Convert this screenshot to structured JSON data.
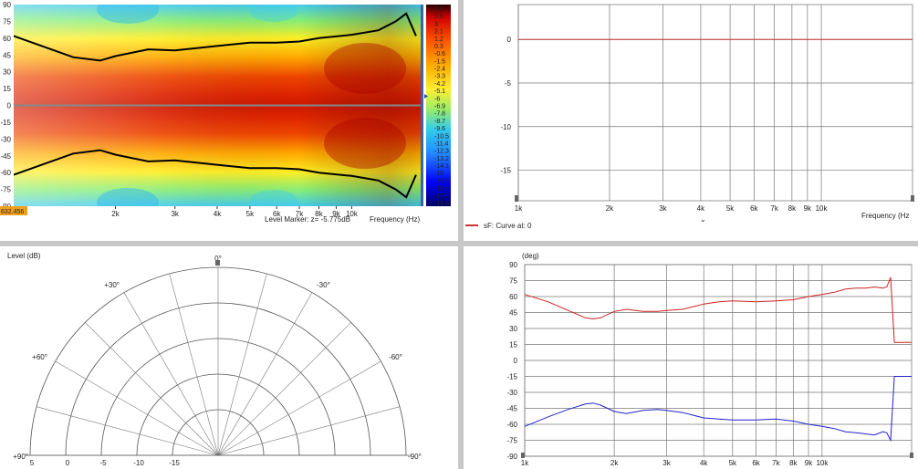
{
  "sonogram": {
    "y_ticks": [
      "90",
      "75",
      "60",
      "45",
      "30",
      "15",
      "0",
      "-15",
      "-30",
      "-45",
      "-60",
      "-75",
      "-90"
    ],
    "x_ticks": [
      "2k",
      "3k",
      "4k",
      "5k",
      "6k",
      "7k",
      "8k",
      "9k",
      "10k"
    ],
    "x_tick_freqs": [
      2000,
      3000,
      4000,
      5000,
      6000,
      7000,
      8000,
      9000,
      10000
    ],
    "x_range": [
      1000,
      16000
    ],
    "y_range": [
      -90,
      90
    ],
    "cursor_readout": "632.456",
    "marker_label": "Level Marker: z= -5.775dB",
    "freq_label": "Frequency (Hz)",
    "colorbar_labels": [
      "4.8",
      "3.9",
      "3",
      "2.1",
      "1.2",
      "0.3",
      "-0.6",
      "-1.5",
      "-2.4",
      "-3.3",
      "-4.2",
      "-5.1",
      "-6",
      "-6.9",
      "-7.8",
      "-8.7",
      "-9.6",
      "-10.5",
      "-11.4",
      "-12.3",
      "-13.2",
      "-14.1",
      "-15",
      "-15.9",
      "-16.8",
      "-17.7",
      "-18.6"
    ],
    "colors": {
      "hot": "#cc1000",
      "warm": "#ffcc00",
      "cool": "#33ccee",
      "cold": "#0000ff"
    }
  },
  "response": {
    "y_ticks": [
      "0",
      "-5",
      "-10",
      "-15"
    ],
    "y_values": [
      0,
      -5,
      -10,
      -15
    ],
    "y_range": [
      -18.5,
      4
    ],
    "x_ticks": [
      "1k",
      "2k",
      "3k",
      "4k",
      "5k",
      "6k",
      "7k",
      "8k",
      "9k",
      "10k"
    ],
    "x_tick_freqs": [
      1000,
      2000,
      3000,
      4000,
      5000,
      6000,
      7000,
      8000,
      9000,
      10000
    ],
    "x_range": [
      1000,
      20000
    ],
    "freq_label": "Frequency (Hz",
    "legend_label": "sF: Curve at: 0",
    "legend_color": "#cc3333",
    "curve_level": 0
  },
  "polar": {
    "level_label": "Level (dB)",
    "angle_labels": [
      "0°",
      "+30°",
      "-30°",
      "+60°",
      "-60°",
      "+90°",
      "-90°"
    ],
    "ring_labels": [
      "5",
      "0",
      "-5",
      "-10",
      "-15"
    ]
  },
  "phase": {
    "y_unit": "(deg)",
    "y_ticks": [
      "90",
      "75",
      "60",
      "45",
      "30",
      "15",
      "0",
      "-15",
      "-30",
      "-45",
      "-60",
      "-75",
      "-90"
    ],
    "y_range": [
      -90,
      90
    ],
    "x_ticks": [
      "1k",
      "2k",
      "3k",
      "4k",
      "5k",
      "6k",
      "7k",
      "8k",
      "9k",
      "10k"
    ],
    "x_tick_freqs": [
      1000,
      2000,
      3000,
      4000,
      5000,
      6000,
      7000,
      8000,
      9000,
      10000
    ],
    "x_range": [
      1000,
      20000
    ]
  },
  "chart_data": [
    {
      "type": "heatmap",
      "title": "",
      "xlabel": "Frequency (Hz)",
      "ylabel": "",
      "x_scale": "log",
      "xlim": [
        1000,
        16000
      ],
      "ylim": [
        -90,
        90
      ],
      "colorbar_range": [
        -18.6,
        4.8
      ],
      "level_marker": -5.775,
      "contour_upper": {
        "x": [
          1000,
          1500,
          1800,
          2000,
          2500,
          3000,
          4000,
          5000,
          6000,
          7000,
          8000,
          10000,
          12000,
          13500,
          14500,
          15000,
          15500
        ],
        "y": [
          62,
          43,
          40,
          44,
          50,
          49,
          53,
          56,
          56,
          57,
          60,
          63,
          67,
          75,
          82,
          72,
          62
        ]
      },
      "contour_lower": {
        "x": [
          1000,
          1500,
          1800,
          2000,
          2500,
          3000,
          4000,
          5000,
          6000,
          7000,
          8000,
          10000,
          12000,
          13500,
          14500,
          15000,
          15500
        ],
        "y": [
          -62,
          -43,
          -40,
          -44,
          -50,
          -49,
          -53,
          -56,
          -56,
          -57,
          -60,
          -63,
          -67,
          -75,
          -82,
          -72,
          -62
        ]
      }
    },
    {
      "type": "line",
      "title": "",
      "xlabel": "Frequency (Hz",
      "x_scale": "log",
      "xlim": [
        1000,
        20000
      ],
      "ylim": [
        -18.5,
        4
      ],
      "series": [
        {
          "name": "sF: Curve at: 0",
          "x": [
            1000,
            20000
          ],
          "y": [
            0,
            0
          ]
        }
      ]
    },
    {
      "type": "line",
      "title": "",
      "ylabel": "(deg)",
      "x_scale": "log",
      "xlim": [
        1000,
        20000
      ],
      "ylim": [
        -90,
        90
      ],
      "series": [
        {
          "x": [
            1000,
            1200,
            1400,
            1600,
            1700,
            1800,
            2000,
            2200,
            2500,
            2800,
            3000,
            3400,
            4000,
            4500,
            5000,
            6000,
            7000,
            8000,
            9000,
            10000,
            11000,
            12000,
            13000,
            14000,
            15000,
            16000,
            16500,
            17000,
            17500,
            20000
          ],
          "y": [
            62,
            55,
            47,
            40,
            39,
            40,
            46,
            48,
            46,
            46,
            47,
            48,
            53,
            55,
            56,
            55,
            56,
            57,
            60,
            62,
            64,
            67,
            68,
            68,
            69,
            68,
            69,
            78,
            17,
            17
          ]
        },
        {
          "x": [
            1000,
            1200,
            1400,
            1600,
            1700,
            1800,
            2000,
            2200,
            2500,
            2800,
            3000,
            3400,
            4000,
            4500,
            5000,
            6000,
            7000,
            8000,
            9000,
            10000,
            11000,
            12000,
            13000,
            14000,
            15000,
            16000,
            16500,
            17000,
            17500,
            20000
          ],
          "y": [
            -62,
            -53,
            -46,
            -41,
            -40,
            -42,
            -48,
            -50,
            -47,
            -46,
            -47,
            -49,
            -54,
            -55,
            -56,
            -56,
            -55,
            -57,
            -60,
            -62,
            -64,
            -67,
            -68,
            -69,
            -70,
            -67,
            -68,
            -75,
            -15,
            -15
          ]
        }
      ]
    },
    {
      "type": "polar",
      "title": "",
      "angle_range": [
        -90,
        90
      ],
      "radial_ticks": [
        5,
        0,
        -5,
        -10,
        -15
      ],
      "series": []
    }
  ]
}
